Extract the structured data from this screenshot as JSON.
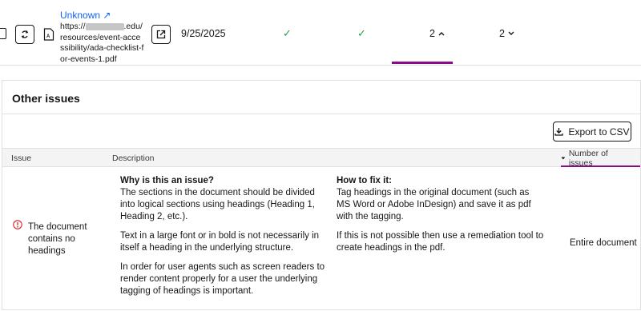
{
  "top_row": {
    "link_title": "Unknown ↗",
    "url_before": "https://",
    "url_after": ".edu/resources/event-accessibility/ada-checklist-for-events-1.pdf",
    "date": "9/25/2025",
    "check_1": "✓",
    "check_2": "✓",
    "count_1": "2",
    "count_2": "2"
  },
  "other_issues": {
    "title": "Other issues",
    "export_label": "Export to CSV",
    "columns": {
      "issue": "Issue",
      "description": "Description",
      "number": "Number of issues"
    },
    "row": {
      "issue_name": "The document contains no headings",
      "why_heading": "Why is this an issue?",
      "why_p1": "The sections in the document should be divided into logical sections using headings (Heading 1, Heading 2, etc.).",
      "why_p2": "Text in a large font or in bold is not necessarily in itself a heading in the underlying structure.",
      "why_p3": "In order for user agents such as screen readers to render content properly for a user the underlying tagging of headings is important.",
      "fix_heading": "How to fix it:",
      "fix_p1": "Tag headings in the original document (such as MS Word or Adobe InDesign) and save it as pdf with the tagging.",
      "fix_p2": "If this is not possible then use a remediation tool to create headings in the pdf.",
      "impact": "Entire document"
    }
  },
  "colors": {
    "accent": "#8a0a8a",
    "link": "#0f62fe",
    "success": "#24a148",
    "error": "#da1e28"
  }
}
